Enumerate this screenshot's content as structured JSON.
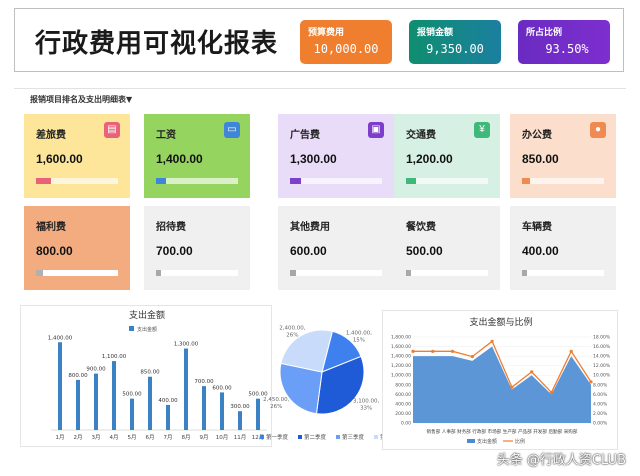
{
  "header": {
    "title": "行政费用可视化报表",
    "kpis": [
      {
        "label": "预算费用",
        "value": "10,000.00",
        "color": "#ef7e2f"
      },
      {
        "label": "报销金额",
        "value": "9,350.00",
        "color": "#0f8e6f"
      },
      {
        "label": "所占比例",
        "value": "93.50%",
        "color": "#6a2bc2"
      }
    ]
  },
  "section": {
    "label": "报销项目排名及支出明细表▼"
  },
  "cards": [
    {
      "name": "差旅费",
      "value": "1,600.00",
      "bg": "#fde69a",
      "accent": "#e8637a",
      "icon": "chart-icon",
      "glyph": "▤",
      "progress": 0.18
    },
    {
      "name": "工资",
      "value": "1,400.00",
      "bg": "#95d45f",
      "accent": "#3f86d9",
      "icon": "document-icon",
      "glyph": "▭",
      "progress": 0.12
    },
    {
      "name": "广告费",
      "value": "1,300.00",
      "bg": "#e8dcf8",
      "accent": "#7d3fc9",
      "icon": "clipboard-icon",
      "glyph": "▣",
      "progress": 0.12
    },
    {
      "name": "交通费",
      "value": "1,200.00",
      "bg": "#d6f0e3",
      "accent": "#3fb97a",
      "icon": "yen-icon",
      "glyph": "¥",
      "progress": 0.12
    },
    {
      "name": "办公费",
      "value": "850.00",
      "bg": "#fbdfcc",
      "accent": "#ef8a50",
      "icon": "user-icon",
      "glyph": "●",
      "progress": 0.1
    },
    {
      "name": "福利费",
      "value": "800.00",
      "bg": "#f2ac80",
      "accent": "#b0b0b0",
      "progress": 0.08
    },
    {
      "name": "招待费",
      "value": "700.00",
      "bg": "#f0f0f0",
      "accent": "#a8a8a8",
      "progress": 0.06
    },
    {
      "name": "其他费用",
      "value": "600.00",
      "bg": "#f0f0f0",
      "accent": "#a8a8a8",
      "progress": 0.06
    },
    {
      "name": "餐饮费",
      "value": "500.00",
      "bg": "#f0f0f0",
      "accent": "#a8a8a8",
      "progress": 0.06
    },
    {
      "name": "车辆费",
      "value": "400.00",
      "bg": "#f0f0f0",
      "accent": "#a8a8a8",
      "progress": 0.06
    }
  ],
  "chart_data": [
    {
      "type": "bar",
      "title": "支出金额",
      "legend": "支出金额",
      "categories": [
        "1月",
        "2月",
        "3月",
        "4月",
        "5月",
        "6月",
        "7月",
        "8月",
        "9月",
        "10月",
        "11月",
        "12月"
      ],
      "values": [
        1400,
        800,
        900,
        1100,
        500,
        850,
        400,
        1300,
        700,
        600,
        300,
        500
      ],
      "data_labels": [
        "1,400.00",
        "800.00",
        "900.00",
        "1,100.00",
        "500.00",
        "850.00",
        "400.00",
        "1,300.00",
        "700.00",
        "600.00",
        "300.00",
        "500.00"
      ],
      "ylim": [
        0,
        1500
      ],
      "color": "#3b82c4"
    },
    {
      "type": "pie",
      "series_labels": [
        "第一季度",
        "第二季度",
        "第三季度",
        "第四季度"
      ],
      "legend_entries": [
        "第一季度",
        "第二季度",
        "第三季度",
        "第四"
      ],
      "values": [
        1400,
        3100,
        2450,
        2400
      ],
      "visible_labels": [
        {
          "text": "2,400.00,",
          "pct": "26%",
          "slice": 3
        },
        {
          "text": "3,100.00,",
          "pct": "33%",
          "slice": 1
        },
        {
          "text": "2,450.00,",
          "pct": "26%",
          "slice": 2
        },
        {
          "text": "1,400.00,",
          "pct": "15%",
          "slice": 0
        }
      ],
      "colors": [
        "#3f80ef",
        "#1f5bd6",
        "#6b9ef7",
        "#c8dbfb"
      ]
    },
    {
      "type": "area",
      "title": "支出金额与比例",
      "categories": [
        "销售部",
        "人事部",
        "财务部",
        "行政部",
        "市场部",
        "生产部",
        "产品部",
        "开发部",
        "后勤部",
        "采购部"
      ],
      "x_tick_text": "销售部 人事部 财务部 行政部 市场部 生产部 产品部 开发部 后勤部 采购部",
      "series": [
        {
          "name": "支出金额",
          "values": [
            1400,
            1400,
            1400,
            1300,
            1600,
            700,
            1000,
            600,
            1400,
            800
          ],
          "color": "#4b8bd3"
        },
        {
          "name": "比例",
          "values": [
            0.15,
            0.15,
            0.15,
            0.139,
            0.171,
            0.075,
            0.107,
            0.064,
            0.15,
            0.086
          ],
          "color": "#ee7d31",
          "axis": "right"
        }
      ],
      "ylim": [
        0,
        1800
      ],
      "y2lim": [
        0,
        0.18
      ],
      "y_ticks": [
        "0.00",
        "200.00",
        "400.00",
        "600.00",
        "800.00",
        "1,000.00",
        "1,200.00",
        "1,400.00",
        "1,600.00",
        "1,800.00"
      ],
      "y2_ticks": [
        "0.00%",
        "2.00%",
        "4.00%",
        "6.00%",
        "8.00%",
        "10.00%",
        "12.00%",
        "14.00%",
        "16.00%",
        "18.00%"
      ],
      "legend": [
        "支出金额",
        "比例"
      ]
    }
  ],
  "watermark": "头条 @行政人资CLUB"
}
